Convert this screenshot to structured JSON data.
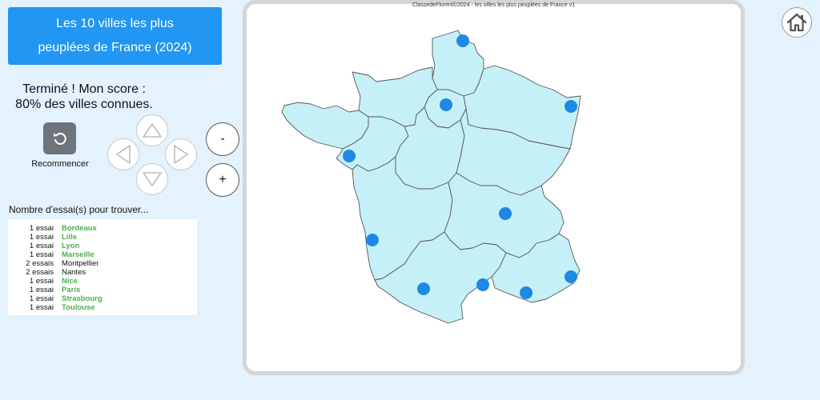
{
  "title": {
    "line1": "Les 10 villes les plus",
    "line2": "peuplées de France (2024)"
  },
  "score": {
    "line1": "Terminé ! Mon score :",
    "line2": "80% des villes connues."
  },
  "controls": {
    "restart_label": "Recommencer",
    "zoom_out": "-",
    "zoom_in": "+"
  },
  "tries": {
    "heading": "Nombre d'essai(s) pour trouver...",
    "rows": [
      {
        "count": "1 essai",
        "city": "Bordeaux",
        "found": true
      },
      {
        "count": "1 essai",
        "city": "Lille",
        "found": true
      },
      {
        "count": "1 essai",
        "city": "Lyon",
        "found": true
      },
      {
        "count": "1 essai",
        "city": "Marseille",
        "found": true
      },
      {
        "count": "2 essais",
        "city": "Montpellier",
        "found": false
      },
      {
        "count": "2 essais",
        "city": "Nantes",
        "found": false
      },
      {
        "count": "1 essai",
        "city": "Nice",
        "found": true
      },
      {
        "count": "1 essai",
        "city": "Paris",
        "found": true
      },
      {
        "count": "1 essai",
        "city": "Strasbourg",
        "found": true
      },
      {
        "count": "1 essai",
        "city": "Toulouse",
        "found": true
      }
    ]
  },
  "map": {
    "caption": "ClassedeFlorent©2024 - les villes les plus peuplées de France v1",
    "land_color": "#c6f0f8",
    "border_color": "#555555",
    "marker_color": "#1e88e5"
  },
  "colors": {
    "accent": "#2196f3",
    "background": "#e3f2fd",
    "found": "#4caf50",
    "restart_button": "#6e747b"
  }
}
